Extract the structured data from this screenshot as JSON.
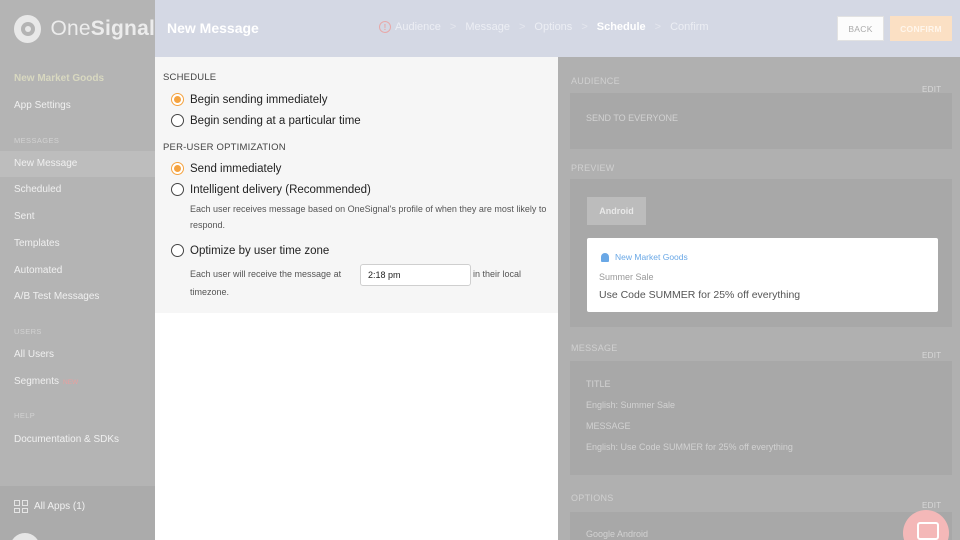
{
  "brand": {
    "name_regular": "One",
    "name_bold": "Signal"
  },
  "sidebar": {
    "app_name": "New Market Goods",
    "app_settings": "App Settings",
    "messages_heading": "MESSAGES",
    "items": [
      {
        "label": "New Message",
        "active": true
      },
      {
        "label": "Scheduled"
      },
      {
        "label": "Sent"
      },
      {
        "label": "Templates"
      },
      {
        "label": "Automated"
      },
      {
        "label": "A/B Test Messages"
      }
    ],
    "users_heading": "USERS",
    "users_items": [
      {
        "label": "All Users"
      },
      {
        "label": "Segments",
        "badge": "NEW"
      }
    ],
    "help_heading": "HELP",
    "help_items": [
      {
        "label": "Documentation & SDKs"
      }
    ],
    "all_apps": "All Apps (1)"
  },
  "header": {
    "title": "New Message",
    "steps": [
      "Audience",
      "Message",
      "Options",
      "Schedule",
      "Confirm"
    ],
    "current_step": "Schedule",
    "separator": ">",
    "warning_glyph": "!",
    "back_label": "BACK",
    "confirm_label": "CONFIRM"
  },
  "schedule": {
    "heading": "SCHEDULE",
    "options": [
      {
        "label": "Begin sending immediately",
        "selected": true
      },
      {
        "label": "Begin sending at a particular time",
        "selected": false
      }
    ]
  },
  "optimization": {
    "heading": "PER-USER OPTIMIZATION",
    "send_immediately": "Send immediately",
    "intelligent_delivery": "Intelligent delivery (Recommended)",
    "intelligent_help": "Each user receives message based on OneSignal's profile of when they are most likely to respond.",
    "timezone": "Optimize by user time zone",
    "timezone_help_pre": "Each user will receive the message at",
    "timezone_help_post_line1": "in their local",
    "timezone_help_post_line2": "timezone.",
    "time_value": "2:18 pm",
    "selected": "Send immediately"
  },
  "summary": {
    "audience": {
      "heading": "AUDIENCE",
      "edit": "EDIT",
      "value": "SEND TO EVERYONE"
    },
    "preview": {
      "heading": "PREVIEW",
      "platform_button": "Android",
      "notification": {
        "app_name": "New Market Goods",
        "title": "Summer Sale",
        "body": "Use Code SUMMER for 25% off everything"
      }
    },
    "message": {
      "heading": "MESSAGE",
      "edit": "EDIT",
      "title_label": "TITLE",
      "title_value": "English: Summer Sale",
      "message_label": "MESSAGE",
      "message_value": "English: Use Code SUMMER for 25% off everything"
    },
    "options": {
      "heading": "OPTIONS",
      "edit": "EDIT",
      "value": "Google Android"
    }
  },
  "colors": {
    "accent_orange": "#f5a340",
    "link_blue": "#6aa8e6"
  }
}
